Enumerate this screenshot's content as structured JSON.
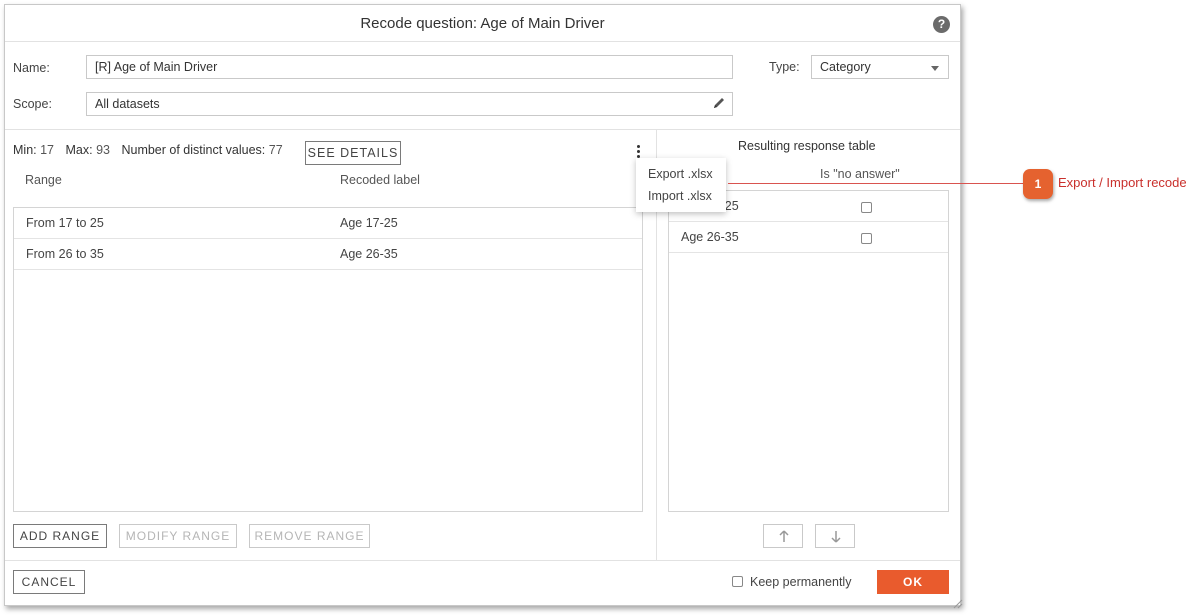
{
  "dialog": {
    "title": "Recode question: Age of Main Driver",
    "help_icon": "?"
  },
  "form": {
    "name_label": "Name:",
    "name_value": "[R] Age of Main Driver",
    "scope_label": "Scope:",
    "scope_value": "All datasets",
    "type_label": "Type:",
    "type_value": "Category"
  },
  "stats": {
    "min_label": "Min:",
    "min_value": "17",
    "max_label": "Max:",
    "max_value": "93",
    "distinct_label": "Number of distinct values:",
    "distinct_value": "77",
    "see_details": "SEE DETAILS"
  },
  "ranges_table": {
    "columns": [
      "Range",
      "Recoded label"
    ],
    "rows": [
      {
        "range": "From 17 to 25",
        "label": "Age 17-25"
      },
      {
        "range": "From 26 to 35",
        "label": "Age 26-35"
      }
    ]
  },
  "context_menu": {
    "items": [
      "Export .xlsx",
      "Import .xlsx"
    ]
  },
  "response_table": {
    "title": "Resulting response table",
    "no_answer_header": "Is \"no answer\"",
    "rows": [
      {
        "label": "Age 17-25",
        "visible_label": "25",
        "no_answer": false
      },
      {
        "label": "Age 26-35",
        "visible_label": "Age 26-35",
        "no_answer": false
      }
    ]
  },
  "range_buttons": {
    "add": "ADD RANGE",
    "modify": "MODIFY RANGE",
    "remove": "REMOVE RANGE"
  },
  "footer": {
    "cancel": "CANCEL",
    "keep_permanently": "Keep permanently",
    "ok": "OK"
  },
  "callout": {
    "number": "1",
    "text": "Export / Import recode"
  },
  "icons": {
    "help": "help-icon",
    "pencil": "pencil-icon",
    "dropdown": "chevron-down-icon",
    "menu": "more-vertical-icon",
    "up": "arrow-up-icon",
    "down": "arrow-down-icon"
  },
  "colors": {
    "accent": "#e95b2d",
    "callout_text": "#c9302c",
    "callout_badge": "#e5622f"
  }
}
